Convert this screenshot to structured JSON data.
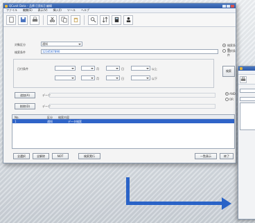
{
  "window": {
    "title": "QCunit Data – 品牌 [[资料]] 编辑",
    "menu": [
      "ファイル",
      "編集(E)",
      "表示(V)",
      "挿入(I)",
      "ツール",
      "ヘルプ"
    ]
  },
  "toolbar": {
    "icons": [
      "new-icon",
      "save-icon",
      "print-icon",
      "cut-icon",
      "copy-icon",
      "paste-icon",
      "find-icon",
      "sort-icon",
      "calc-icon",
      "user-icon"
    ]
  },
  "form": {
    "field1_label": "対象区分",
    "field1_value": "通知",
    "field2_label": "検索条件",
    "field2_value": "1234567890",
    "range_label": "日付条件",
    "range_unit_year": "年",
    "range_unit_month": "月",
    "range_unit_day": "日",
    "range_suffix": "以上",
    "range_suffix2": "以下",
    "btn_a": "追加(A)",
    "btn_b": "削除(D)",
    "note_a": "データ",
    "note_b": "データ",
    "right_opt1": "検索条件",
    "right_opt2": "選択条件",
    "right_btn": "検索",
    "mid_opts": [
      "AND",
      "OR"
    ]
  },
  "grid": {
    "headers": [
      "No.",
      "区分",
      "検索内容"
    ],
    "rows": [
      {
        "no": "1",
        "kind": "通知",
        "content": "データ検索"
      }
    ]
  },
  "footer": {
    "buttons": [
      "全選択",
      "全解除",
      "NOT",
      "検索実行"
    ],
    "right_buttons": [
      "一覧表示",
      "終了"
    ]
  },
  "colors": {
    "accent": "#2f64c8",
    "arrow": "#2a63c7"
  }
}
